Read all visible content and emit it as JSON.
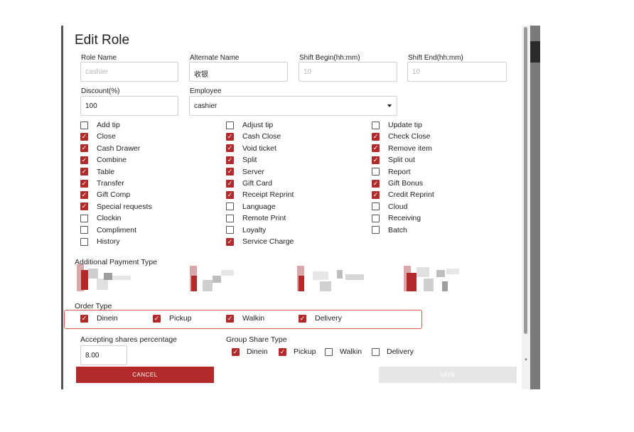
{
  "dialog": {
    "title": "Edit Role"
  },
  "fields": {
    "role_name": {
      "label": "Role Name",
      "placeholder": "cashier",
      "value": ""
    },
    "alternate_name": {
      "label": "Alternate Name",
      "value": "收银"
    },
    "shift_begin": {
      "label": "Shift Begin(hh:mm)",
      "placeholder": "10",
      "value": ""
    },
    "shift_end": {
      "label": "Shift End(hh:mm)",
      "placeholder": "10",
      "value": ""
    },
    "discount": {
      "label": "Discount(%)",
      "value": "100"
    },
    "employee": {
      "label": "Employee",
      "value": "cashier"
    }
  },
  "permissions": {
    "col1": [
      {
        "label": "Add tip",
        "checked": false
      },
      {
        "label": "Close",
        "checked": true
      },
      {
        "label": "Cash Drawer",
        "checked": true
      },
      {
        "label": "Combine",
        "checked": true
      },
      {
        "label": "Table",
        "checked": true
      },
      {
        "label": "Transfer",
        "checked": true
      },
      {
        "label": "Gift Comp",
        "checked": true
      },
      {
        "label": "Special requests",
        "checked": true
      },
      {
        "label": "Clockin",
        "checked": false
      },
      {
        "label": "Compliment",
        "checked": false
      },
      {
        "label": "History",
        "checked": false
      }
    ],
    "col2": [
      {
        "label": "Adjust tip",
        "checked": false
      },
      {
        "label": "Cash Close",
        "checked": true
      },
      {
        "label": "Void ticket",
        "checked": true
      },
      {
        "label": "Split",
        "checked": true
      },
      {
        "label": "Server",
        "checked": true
      },
      {
        "label": "Gift Card",
        "checked": true
      },
      {
        "label": "Receipt Reprint",
        "checked": true
      },
      {
        "label": "Language",
        "checked": false
      },
      {
        "label": "Remote Print",
        "checked": false
      },
      {
        "label": "Loyalty",
        "checked": false
      },
      {
        "label": "Service Charge",
        "checked": true
      }
    ],
    "col3": [
      {
        "label": "Update tip",
        "checked": false
      },
      {
        "label": "Check Close",
        "checked": true
      },
      {
        "label": "Remove item",
        "checked": true
      },
      {
        "label": "Split out",
        "checked": true
      },
      {
        "label": "Report",
        "checked": false
      },
      {
        "label": "Gift Bonus",
        "checked": true
      },
      {
        "label": "Credit Reprint",
        "checked": true
      },
      {
        "label": "Cloud",
        "checked": false
      },
      {
        "label": "Receiving",
        "checked": false
      },
      {
        "label": "Batch",
        "checked": false
      }
    ]
  },
  "additional_payment": {
    "label": "Additional Payment Type"
  },
  "order_type": {
    "label": "Order Type",
    "options": [
      {
        "label": "Dinein",
        "checked": true
      },
      {
        "label": "Pickup",
        "checked": true
      },
      {
        "label": "Walkin",
        "checked": true
      },
      {
        "label": "Delivery",
        "checked": true
      }
    ]
  },
  "accepting_shares": {
    "label": "Accepting shares percentage",
    "value": "8.00"
  },
  "group_share": {
    "label": "Group Share Type",
    "options": [
      {
        "label": "Dinein",
        "checked": true
      },
      {
        "label": "Pickup",
        "checked": true
      },
      {
        "label": "Walkin",
        "checked": false
      },
      {
        "label": "Delivery",
        "checked": false
      }
    ]
  },
  "buttons": {
    "cancel": "CANCEL",
    "save": "SAVE"
  },
  "colors": {
    "accent": "#b22a2a",
    "highlight_border": "#d05a45"
  }
}
